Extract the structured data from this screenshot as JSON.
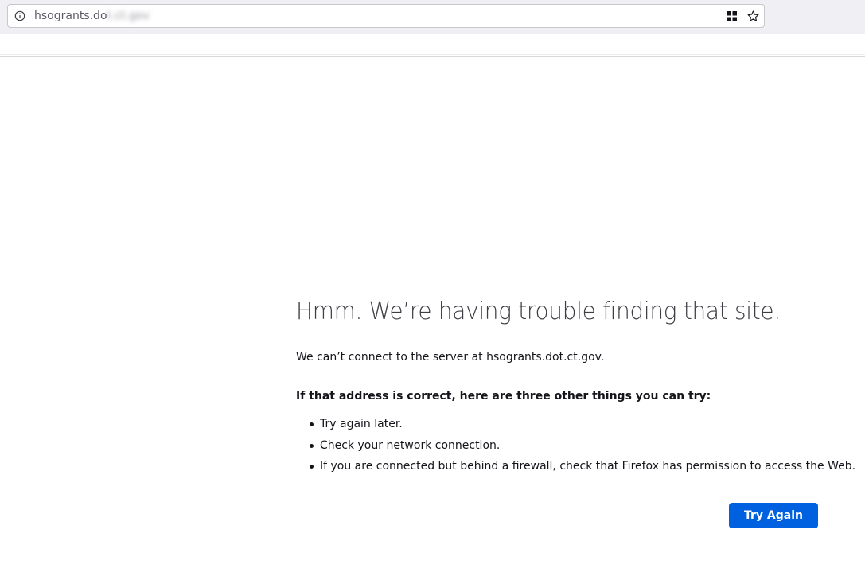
{
  "browser": {
    "url_visible": "hsogrants.do",
    "url_obscured": "t.ct.gov",
    "icons": {
      "info": "info-icon",
      "grid": "grid-icon",
      "bookmark": "star-icon"
    }
  },
  "error_page": {
    "title": "Hmm. We’re having trouble finding that site.",
    "description": "We can’t connect to the server at hsogrants.dot.ct.gov.",
    "tips_heading": "If that address is correct, here are three other things you can try:",
    "tips": [
      "Try again later.",
      "Check your network connection.",
      "If you are connected but behind a firewall, check that Firefox has permission to access the Web."
    ],
    "try_again_label": "Try Again"
  },
  "colors": {
    "accent": "#0061e0",
    "toolbar": "#f0f0f4",
    "text": "#15141a"
  }
}
